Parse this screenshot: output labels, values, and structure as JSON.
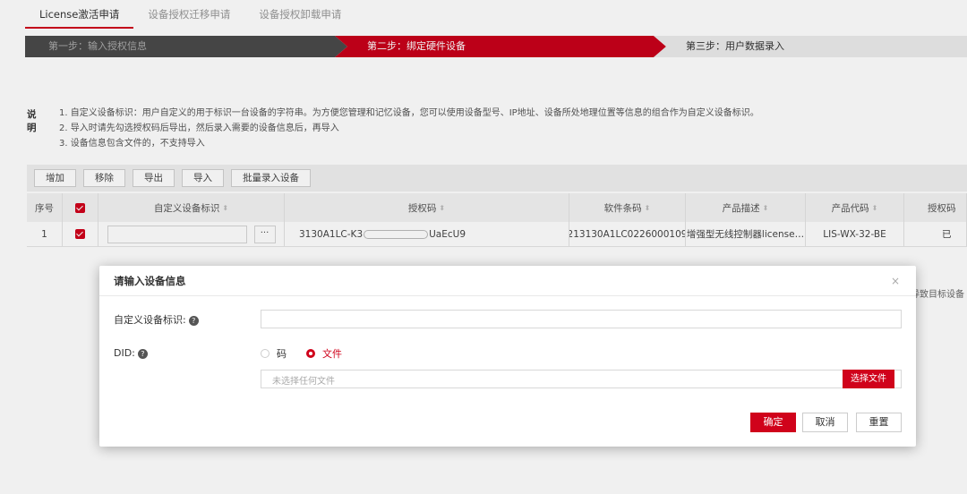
{
  "tabs": [
    {
      "label": "License激活申请"
    },
    {
      "label": "设备授权迁移申请"
    },
    {
      "label": "设备授权卸载申请"
    }
  ],
  "steps": [
    {
      "label": "第一步：输入授权信息"
    },
    {
      "label": "第二步：绑定硬件设备"
    },
    {
      "label": "第三步：用户数据录入"
    }
  ],
  "notes": {
    "title": "说明",
    "items": [
      "1. 自定义设备标识：用户自定义的用于标识一台设备的字符串。为方便您管理和记忆设备，您可以使用设备型号、IP地址、设备所处地理位置等信息的组合作为自定义设备标识。",
      "2. 导入时请先勾选授权码后导出，然后录入需要的设备信息后，再导入",
      "3. 设备信息包含文件的，不支持导入"
    ]
  },
  "toolbar": {
    "add": "增加",
    "remove": "移除",
    "export": "导出",
    "import": "导入",
    "batch": "批量录入设备"
  },
  "table": {
    "headers": {
      "seq": "序号",
      "device_id": "自定义设备标识",
      "auth_code": "授权码",
      "software_code": "软件条码",
      "product_desc": "产品描述",
      "product_code": "产品代码",
      "auth_code_clip": "授权码"
    },
    "sort_icon": "⬍",
    "row": {
      "seq": "1",
      "more": "···",
      "auth_code_start": "3130A1LC-K3",
      "auth_code_end": "UaEcU9",
      "software_code": "213130A1LC0226000109",
      "product_desc": "增强型无线控制器license…",
      "product_code": "LIS-WX-32-BE",
      "status_clip": "已"
    },
    "right_clip": "导致目标设备"
  },
  "modal": {
    "title": "请输入设备信息",
    "close": "×",
    "device_label": "自定义设备标识:",
    "did_label": "DID:",
    "qmark": "?",
    "radio_code": "码",
    "radio_file": "文件",
    "file_placeholder": "未选择任何文件",
    "choose_file": "选择文件",
    "ok": "确定",
    "cancel": "取消",
    "reset": "重置"
  },
  "colors": {
    "accent": "#d0021b",
    "step_done": "#4a4a4a",
    "step_current": "#c8001a",
    "step_next": "#ebebeb"
  }
}
